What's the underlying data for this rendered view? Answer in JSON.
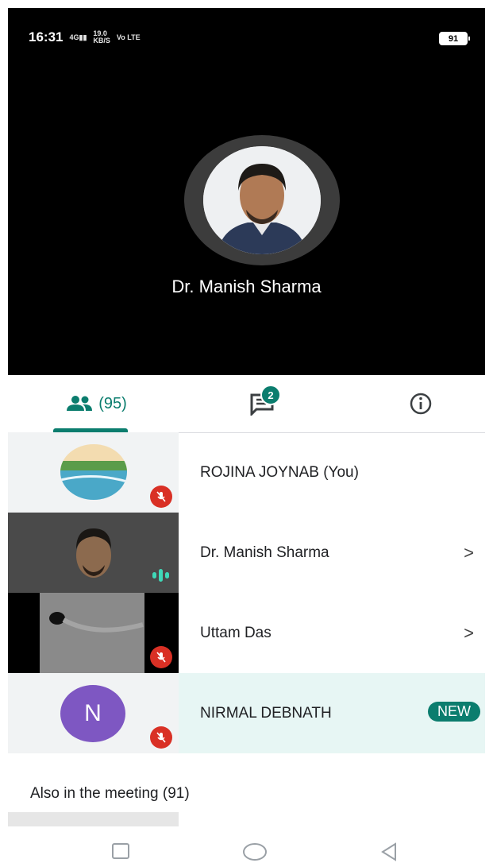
{
  "status_bar": {
    "time": "16:31",
    "network": "4G",
    "speed": "19.0",
    "speed_unit": "KB/S",
    "volte": "Vo LTE",
    "battery": "91"
  },
  "stage": {
    "speaker_name": "Dr. Manish Sharma"
  },
  "tabs": {
    "people_count": "(95)",
    "chat_badge": "2"
  },
  "participants": [
    {
      "name": "ROJINA JOYNAB (You)",
      "muted": true
    },
    {
      "name": "Dr. Manish Sharma",
      "speaking": true,
      "chevron": ">"
    },
    {
      "name": "Uttam Das",
      "muted": true,
      "chevron": ">"
    },
    {
      "name": "NIRMAL DEBNATH",
      "initial": "N",
      "muted": true,
      "badge": "NEW"
    }
  ],
  "also_in_meeting": "Also in the meeting (91)",
  "colors": {
    "accent": "#0b7d6e",
    "mute": "#d93025",
    "new_row_bg": "#e7f6f4",
    "avatar_n": "#7e57c2"
  }
}
